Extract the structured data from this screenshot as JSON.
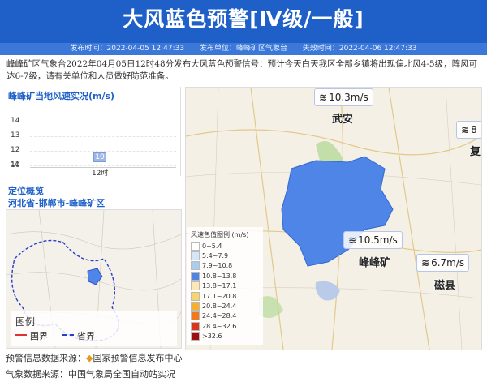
{
  "header": {
    "title": "大风蓝色预警[Ⅳ级/一般]",
    "publish_time": "发布时间：2022-04-05 12:47:33",
    "publisher": "发布单位：峰峰矿区气象台",
    "expire_time": "失效时间：2022-04-06 12:47:33"
  },
  "notice": "峰峰矿区气象台2022年04月05日12时48分发布大风蓝色预警信号：预计今天白天我区全部乡镇将出现偏北风4-5级，阵风可达6-7级，请有关单位和人员做好防范准备。",
  "wind_panel": {
    "title": "峰峰矿当地风速实况(m/s)",
    "y_ticks": [
      "14",
      "13",
      "12",
      "11",
      "10"
    ],
    "bar_value": "10",
    "x_label": "12时"
  },
  "location_panel": {
    "title": "定位概览",
    "region": "河北省-邯郸市-峰峰矿区",
    "legend_title": "图例",
    "legend_country": "国界",
    "legend_province": "省界"
  },
  "main_map": {
    "stations": [
      {
        "value": "10.3m/s"
      },
      {
        "value": "8"
      },
      {
        "value": "10.5m/s"
      },
      {
        "value": "6.7m/s"
      }
    ],
    "places": {
      "wuan": "武安",
      "fengfeng": "峰峰矿",
      "cixian": "磁县",
      "she": "复"
    },
    "legend_title": "风速色值图例 (m/s)",
    "legend": [
      {
        "label": "0~5.4",
        "color": "#ffffff"
      },
      {
        "label": "5.4~7.9",
        "color": "#d6e6f7"
      },
      {
        "label": "7.9~10.8",
        "color": "#a7cdf0"
      },
      {
        "label": "10.8~13.8",
        "color": "#4f85e6"
      },
      {
        "label": "13.8~17.1",
        "color": "#fbe8b6"
      },
      {
        "label": "17.1~20.8",
        "color": "#f8d56a"
      },
      {
        "label": "20.8~24.4",
        "color": "#f6b12a"
      },
      {
        "label": "24.4~28.4",
        "color": "#ef7a1c"
      },
      {
        "label": "28.4~32.6",
        "color": "#d9361d"
      },
      {
        "label": ">32.6",
        "color": "#9e1010"
      }
    ]
  },
  "footer": {
    "source1": "预警信息数据来源：",
    "source1_name": "国家预警信息发布中心",
    "source2": "气象数据来源：中国气象局全国自动站实况"
  }
}
